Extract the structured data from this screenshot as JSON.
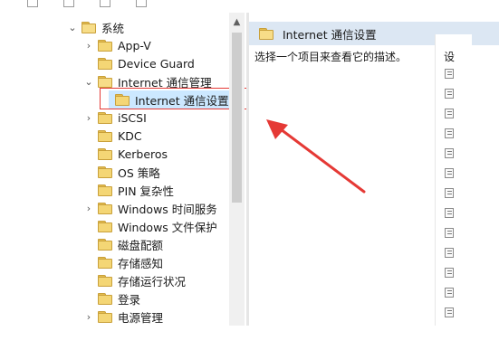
{
  "tree": {
    "root": {
      "label": "系统",
      "expanded": true
    },
    "items": [
      {
        "label": "App-V",
        "expandable": true
      },
      {
        "label": "Device Guard",
        "expandable": false
      },
      {
        "label": "Internet 通信管理",
        "expandable": true,
        "expanded": true
      },
      {
        "label": "Internet 通信设置",
        "expandable": false,
        "selected": true
      },
      {
        "label": "iSCSI",
        "expandable": true
      },
      {
        "label": "KDC",
        "expandable": false
      },
      {
        "label": "Kerberos",
        "expandable": false
      },
      {
        "label": "OS 策略",
        "expandable": false
      },
      {
        "label": "PIN 复杂性",
        "expandable": false
      },
      {
        "label": "Windows 时间服务",
        "expandable": true
      },
      {
        "label": "Windows 文件保护",
        "expandable": false
      },
      {
        "label": "磁盘配额",
        "expandable": false
      },
      {
        "label": "存储感知",
        "expandable": false
      },
      {
        "label": "存储运行状况",
        "expandable": false
      },
      {
        "label": "登录",
        "expandable": false
      },
      {
        "label": "电源管理",
        "expandable": true
      }
    ]
  },
  "right_panel": {
    "header_title": "Internet 通信设置",
    "description": "选择一个项目来查看它的描述。",
    "column_header": "设"
  },
  "colors": {
    "selection": "#cce8ff",
    "highlight_box": "#e53935",
    "arrow": "#e53935",
    "header_bg": "#dce7f3"
  }
}
